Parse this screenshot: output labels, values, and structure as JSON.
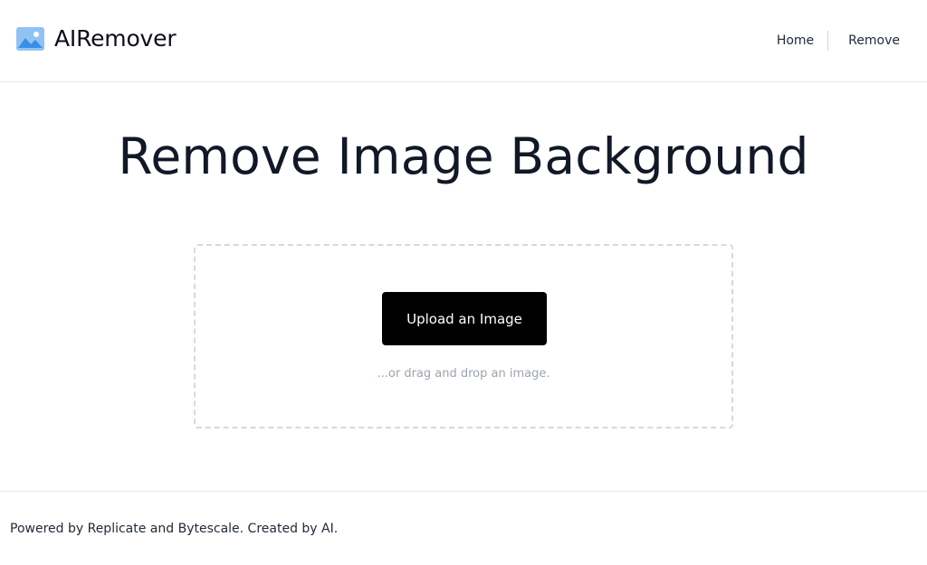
{
  "header": {
    "brand_name": "AIRemover",
    "brand_icon": "image-icon",
    "nav": [
      {
        "label": "Home"
      },
      {
        "label": "Remove"
      }
    ]
  },
  "main": {
    "title": "Remove Image Background",
    "upload_button_label": "Upload an Image",
    "drop_hint": "...or drag and drop an image."
  },
  "footer": {
    "text": "Powered by Replicate and Bytescale. Created by AI."
  },
  "colors": {
    "accent_button": "#000000",
    "icon_sky": "#8fc3f3",
    "icon_mountain": "#3a8ee6"
  }
}
